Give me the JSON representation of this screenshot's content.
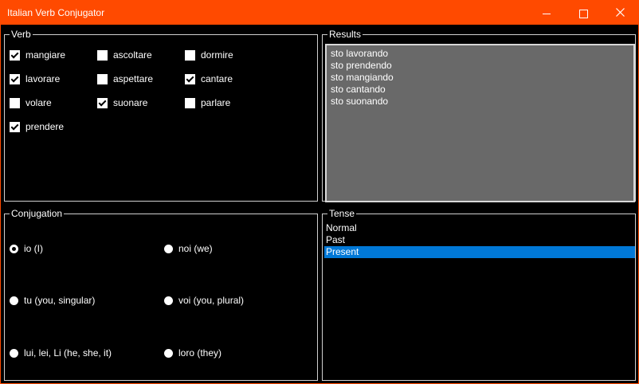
{
  "window": {
    "title": "Italian Verb Conjugator",
    "accent_color": "#ff4a00",
    "controls": {
      "minimize_icon": "minimize-icon",
      "maximize_icon": "maximize-icon",
      "close_icon": "close-icon"
    }
  },
  "verb": {
    "legend": "Verb",
    "items": [
      {
        "label": "mangiare",
        "checked": true
      },
      {
        "label": "ascoltare",
        "checked": false
      },
      {
        "label": "dormire",
        "checked": false
      },
      {
        "label": "lavorare",
        "checked": true
      },
      {
        "label": "aspettare",
        "checked": false
      },
      {
        "label": "cantare",
        "checked": true
      },
      {
        "label": "volare",
        "checked": false
      },
      {
        "label": "suonare",
        "checked": true
      },
      {
        "label": "parlare",
        "checked": false
      },
      {
        "label": "prendere",
        "checked": true
      }
    ]
  },
  "results": {
    "legend": "Results",
    "lines": [
      "sto lavorando",
      "sto prendendo",
      "sto mangiando",
      "sto cantando",
      "sto suonando"
    ],
    "background": "#696969"
  },
  "conjugation": {
    "legend": "Conjugation",
    "options": [
      {
        "label": "io (I)",
        "selected": true
      },
      {
        "label": "noi (we)",
        "selected": false
      },
      {
        "label": "tu (you, singular)",
        "selected": false
      },
      {
        "label": "voi (you, plural)",
        "selected": false
      },
      {
        "label": "lui, lei, Li (he, she, it)",
        "selected": false
      },
      {
        "label": "loro (they)",
        "selected": false
      }
    ]
  },
  "tense": {
    "legend": "Tense",
    "options": [
      {
        "label": "Normal",
        "selected": false
      },
      {
        "label": "Past",
        "selected": false
      },
      {
        "label": "Present",
        "selected": true
      }
    ],
    "selected_color": "#0078d7"
  }
}
